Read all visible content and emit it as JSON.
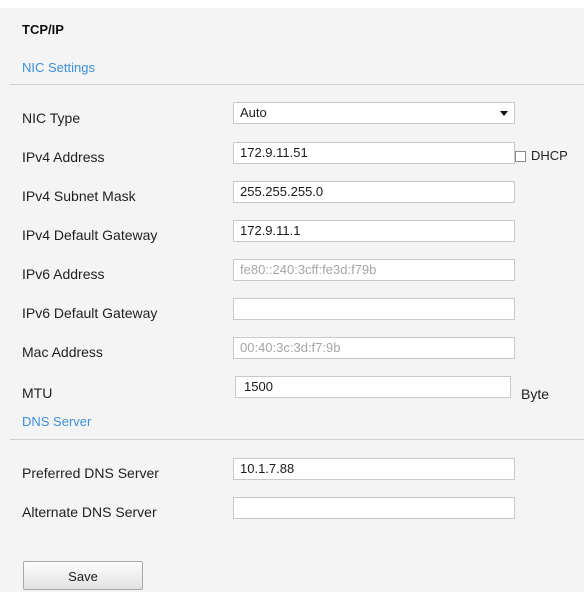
{
  "page": {
    "title": "TCP/IP",
    "sections": {
      "nic": "NIC Settings",
      "dns": "DNS Server"
    }
  },
  "nic": {
    "type_label": "NIC Type",
    "type_value": "Auto",
    "ipv4_address_label": "IPv4 Address",
    "ipv4_address_value": "172.9.11.51",
    "dhcp_label": "DHCP",
    "dhcp_checked": false,
    "ipv4_subnet_label": "IPv4 Subnet Mask",
    "ipv4_subnet_value": "255.255.255.0",
    "ipv4_gateway_label": "IPv4 Default Gateway",
    "ipv4_gateway_value": "172.9.11.1",
    "ipv6_address_label": "IPv6 Address",
    "ipv6_address_value": "fe80::240:3cff:fe3d:f79b",
    "ipv6_gateway_label": "IPv6 Default Gateway",
    "ipv6_gateway_value": "",
    "mac_label": "Mac Address",
    "mac_value": "00:40:3c:3d:f7:9b",
    "mtu_label": "MTU",
    "mtu_value": "1500",
    "mtu_unit": "Byte"
  },
  "dns": {
    "preferred_label": "Preferred DNS Server",
    "preferred_value": "10.1.7.88",
    "alternate_label": "Alternate DNS Server",
    "alternate_value": ""
  },
  "actions": {
    "save_label": "Save"
  },
  "colors": {
    "section_heading": "#3d8fd8",
    "background": "#f4f4f4",
    "disabled_text": "#a5a5a5"
  }
}
